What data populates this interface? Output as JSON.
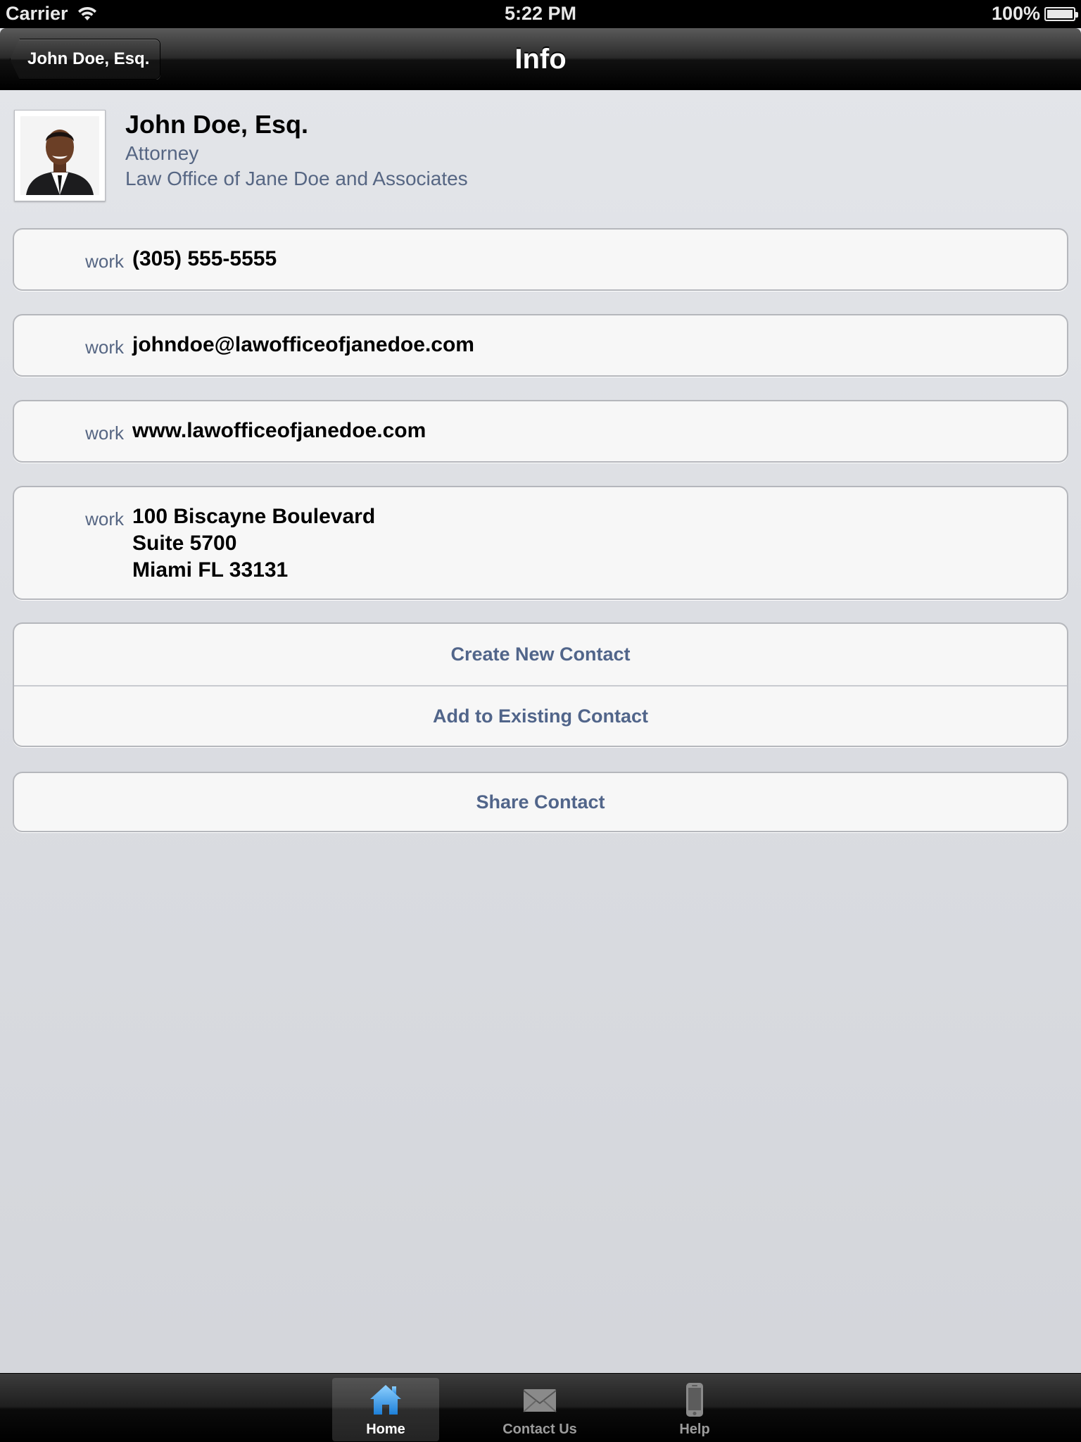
{
  "status_bar": {
    "carrier": "Carrier",
    "time": "5:22 PM",
    "battery": "100%",
    "icons": [
      "wifi-icon",
      "battery-icon"
    ]
  },
  "nav_bar": {
    "back_label": "John Doe, Esq.",
    "title": "Info"
  },
  "profile": {
    "name": "John Doe, Esq.",
    "title": "Attorney",
    "organization": "Law Office of Jane Doe and Associates",
    "avatar_icon": "person-photo"
  },
  "contact_fields": [
    {
      "label": "work",
      "value": "(305) 555-5555"
    },
    {
      "label": "work",
      "value": "johndoe@lawofficeofjanedoe.com"
    },
    {
      "label": "work",
      "value": "www.lawofficeofjanedoe.com"
    },
    {
      "label": "work",
      "lines": [
        "100 Biscayne Boulevard",
        "Suite 5700",
        "Miami FL 33131"
      ]
    }
  ],
  "actions": {
    "create_new": "Create New Contact",
    "add_existing": "Add to Existing Contact",
    "share": "Share Contact"
  },
  "tab_bar": {
    "tabs": [
      {
        "label": "Home",
        "icon": "home-icon",
        "active": true
      },
      {
        "label": "Contact Us",
        "icon": "envelope-icon",
        "active": false
      },
      {
        "label": "Help",
        "icon": "phone-icon",
        "active": false
      }
    ]
  },
  "colors": {
    "label_blue": "#566683",
    "action_blue": "#51658a",
    "background": "#dcdee2"
  }
}
